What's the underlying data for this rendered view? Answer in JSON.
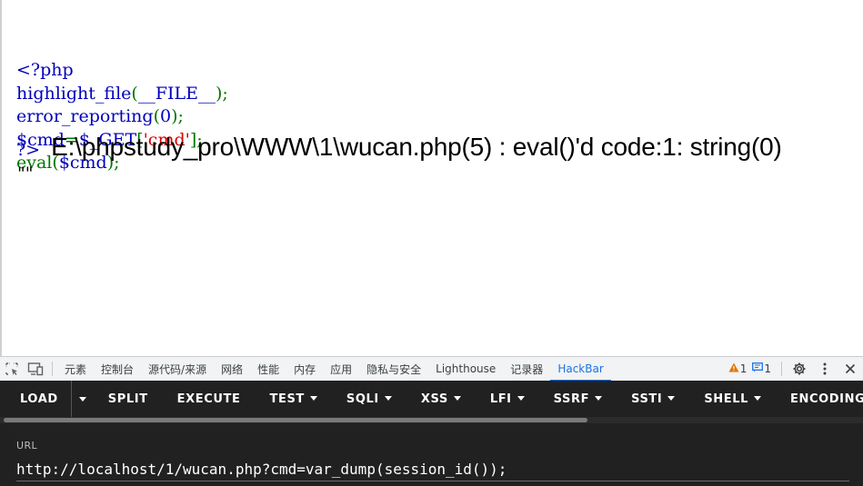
{
  "page": {
    "code_lines": [
      [
        {
          "t": "<?php",
          "c": "blue"
        }
      ],
      [
        {
          "t": "highlight_file",
          "c": "blue"
        },
        {
          "t": "(",
          "c": "green"
        },
        {
          "t": "__FILE__",
          "c": "blue"
        },
        {
          "t": ");",
          "c": "green"
        }
      ],
      [
        {
          "t": "error_reporting",
          "c": "blue"
        },
        {
          "t": "(",
          "c": "green"
        },
        {
          "t": "0",
          "c": "blue"
        },
        {
          "t": ");",
          "c": "green"
        }
      ],
      [
        {
          "t": "$cmd",
          "c": "blue"
        },
        {
          "t": "=",
          "c": "green"
        },
        {
          "t": "$_GET",
          "c": "blue"
        },
        {
          "t": "[",
          "c": "green"
        },
        {
          "t": "'cmd'",
          "c": "red"
        },
        {
          "t": "];",
          "c": "green"
        }
      ],
      [
        {
          "t": "eval",
          "c": "green"
        },
        {
          "t": "(",
          "c": "green"
        },
        {
          "t": "$cmd",
          "c": "blue"
        },
        {
          "t": ");",
          "c": "green"
        }
      ]
    ],
    "php_close": "?>",
    "error_text": "E:\\phpstudy_pro\\WWW\\1\\wucan.php(5) : eval()'d code:1: string(0)",
    "result_text": "\"\"",
    "colors": {
      "blue": "#0000bb",
      "green": "#007700",
      "red": "#dd0000"
    }
  },
  "devtools": {
    "tabs": [
      "元素",
      "控制台",
      "源代码/来源",
      "网络",
      "性能",
      "内存",
      "应用",
      "隐私与安全",
      "Lighthouse",
      "记录器",
      "HackBar"
    ],
    "active_tab": "HackBar",
    "warnings_count": "1",
    "messages_count": "1",
    "icons": [
      "inspect-icon",
      "device-toggle-icon",
      "warning-icon",
      "message-icon",
      "gear-icon",
      "kebab-menu-icon",
      "close-icon"
    ]
  },
  "hackbar": {
    "buttons": [
      {
        "label": "LOAD",
        "dropdown": false
      },
      {
        "label": "SPLIT",
        "dropdown": false
      },
      {
        "label": "EXECUTE",
        "dropdown": false
      },
      {
        "label": "TEST",
        "dropdown": true
      },
      {
        "label": "SQLI",
        "dropdown": true
      },
      {
        "label": "XSS",
        "dropdown": true
      },
      {
        "label": "LFI",
        "dropdown": true
      },
      {
        "label": "SSRF",
        "dropdown": true
      },
      {
        "label": "SSTI",
        "dropdown": true
      },
      {
        "label": "SHELL",
        "dropdown": true
      },
      {
        "label": "ENCODING",
        "dropdown": true
      }
    ],
    "url_label": "URL",
    "url_value": "http://localhost/1/wucan.php?cmd=var_dump(session_id());",
    "accent_color": "#212121"
  }
}
